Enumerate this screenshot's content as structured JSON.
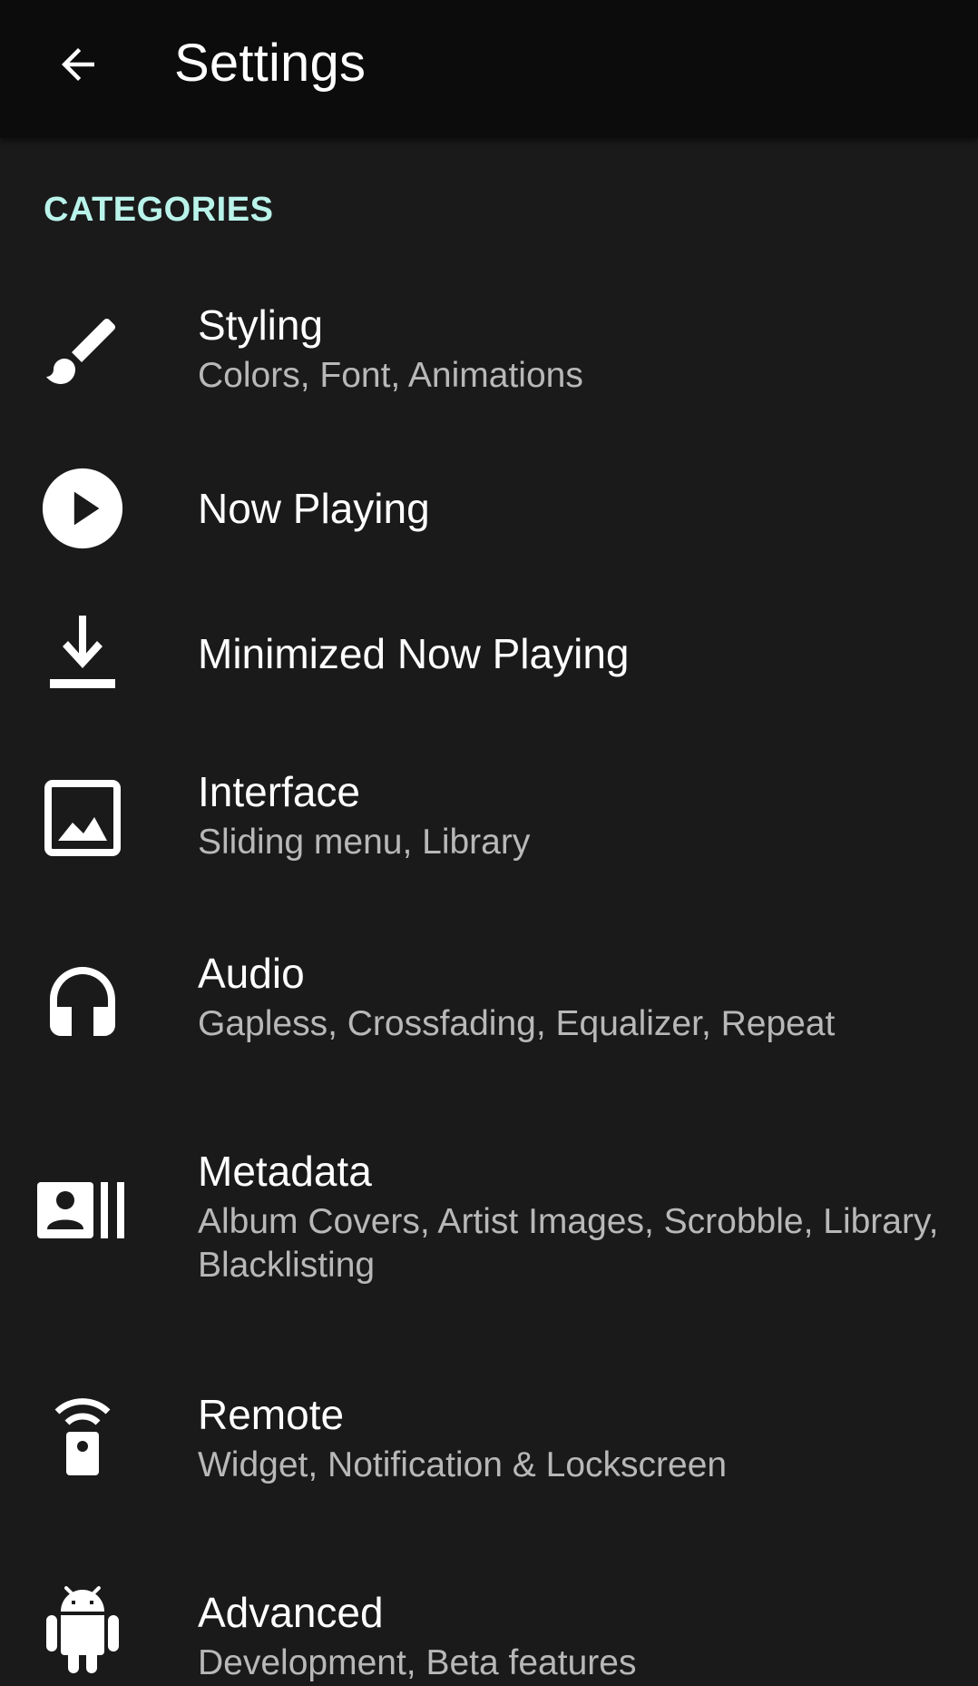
{
  "app_bar": {
    "title": "Settings",
    "back_icon": "arrow-back-icon"
  },
  "colors": {
    "app_bar_bg": "#0c0c0c",
    "background": "#1a1a1b",
    "accent": "#b9f3ea",
    "summary_text": "#b8b8b8"
  },
  "section": {
    "header": "CATEGORIES"
  },
  "items": [
    {
      "title": "Styling",
      "summary": "Colors, Font, Animations",
      "icon": "brush-icon"
    },
    {
      "title": "Now Playing",
      "summary": "",
      "icon": "play-circle-icon"
    },
    {
      "title": "Minimized Now Playing",
      "summary": "",
      "icon": "download-icon"
    },
    {
      "title": "Interface",
      "summary": "Sliding menu, Library",
      "icon": "image-icon"
    },
    {
      "title": "Audio",
      "summary": "Gapless, Crossfading, Equalizer, Repeat",
      "icon": "headphones-icon"
    },
    {
      "title": "Metadata",
      "summary": "Album Covers, Artist Images, Scrobble, Library, Blacklisting",
      "icon": "contacts-library-icon"
    },
    {
      "title": "Remote",
      "summary": "Widget, Notification & Lockscreen",
      "icon": "remote-icon"
    },
    {
      "title": "Advanced",
      "summary": "Development, Beta features",
      "icon": "android-icon"
    }
  ]
}
